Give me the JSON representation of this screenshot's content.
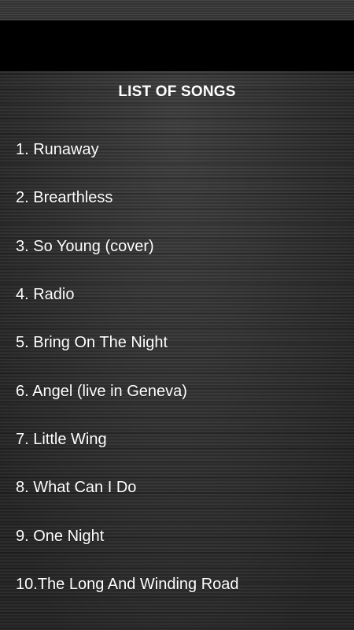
{
  "header": {
    "title": "LIST OF SONGS"
  },
  "songs": [
    {
      "label": "1. Runaway"
    },
    {
      "label": "2. Brearthless"
    },
    {
      "label": "3. So Young (cover)"
    },
    {
      "label": "4. Radio"
    },
    {
      "label": "5. Bring On The Night"
    },
    {
      "label": "6. Angel (live in Geneva)"
    },
    {
      "label": "7. Little Wing"
    },
    {
      "label": "8. What Can I Do"
    },
    {
      "label": "9. One Night"
    },
    {
      "label": "10.The Long And Winding Road"
    }
  ],
  "colors": {
    "text": "#ffffff",
    "top_bar": "#000000",
    "background": "#333333"
  }
}
